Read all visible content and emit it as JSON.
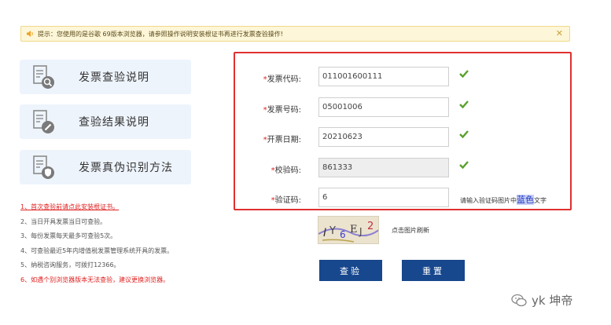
{
  "notice": {
    "text": "提示：您使用的是谷歌 69版本浏览器，请参照操作说明安装根证书再进行发票查验操作!",
    "close": "✕"
  },
  "sidebar": {
    "items": [
      {
        "label": "发票查验说明",
        "icon": "document-search-icon"
      },
      {
        "label": "查验结果说明",
        "icon": "document-edit-icon"
      },
      {
        "label": "发票真伪识别方法",
        "icon": "document-shield-icon"
      }
    ]
  },
  "notes": [
    "1、首次查验前请点此安装根证书。",
    "2、当日开具发票当日可查验。",
    "3、每份发票每天最多可查验5次。",
    "4、可查验最近5年内增值税发票管理系统开具的发票。",
    "5、纳税咨询服务，可拨打12366。",
    "6、如遇个别浏览器版本无法查验，建议更换浏览器。"
  ],
  "form": {
    "invoice_code": {
      "label": "发票代码:",
      "value": "011001600111"
    },
    "invoice_number": {
      "label": "发票号码:",
      "value": "05001006"
    },
    "issue_date": {
      "label": "开票日期:",
      "value": "20210623"
    },
    "check_code": {
      "label": "校验码:",
      "value": "861333"
    },
    "captcha": {
      "label": "验证码:",
      "value": "6",
      "hint_prefix": "请输入验证码图片中",
      "hint_color_word": "蓝色",
      "hint_suffix": "文字"
    }
  },
  "captcha_refresh": "点击图片刷新",
  "buttons": {
    "check": "查验",
    "reset": "重置"
  },
  "watermark": "yk 坤帝",
  "colors": {
    "primary": "#17478d",
    "error_border": "#e03030",
    "check_green": "#5aa02c",
    "required": "#e02020"
  }
}
